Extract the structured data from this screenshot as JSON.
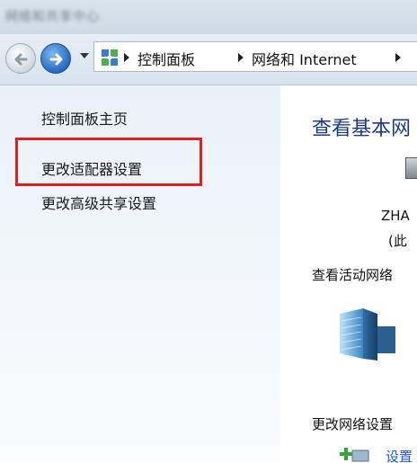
{
  "window": {
    "title_text": "网络和共享中心"
  },
  "navbar": {
    "back_icon": "back-arrow-icon",
    "forward_icon": "forward-arrow-icon",
    "history_dropdown_icon": "chevron-down-icon",
    "breadcrumb": [
      {
        "label": "控制面板"
      },
      {
        "label": "网络和 Internet"
      }
    ]
  },
  "left_pane": {
    "links": [
      {
        "label": "控制面板主页"
      },
      {
        "label": "更改适配器设置"
      },
      {
        "label": "更改高级共享设置"
      }
    ],
    "highlight_color": "#e0201c"
  },
  "right_pane": {
    "title": "查看基本网",
    "computer_name": "ZHA",
    "this_computer": "(此",
    "active_networks_label": "查看活动网络",
    "change_settings_label": "更改网络设置",
    "setup_link": "设置"
  },
  "colors": {
    "title_blue": "#1e3a8a",
    "link_blue": "#1f5bd6",
    "pane_bg": "#eaf1f8"
  }
}
